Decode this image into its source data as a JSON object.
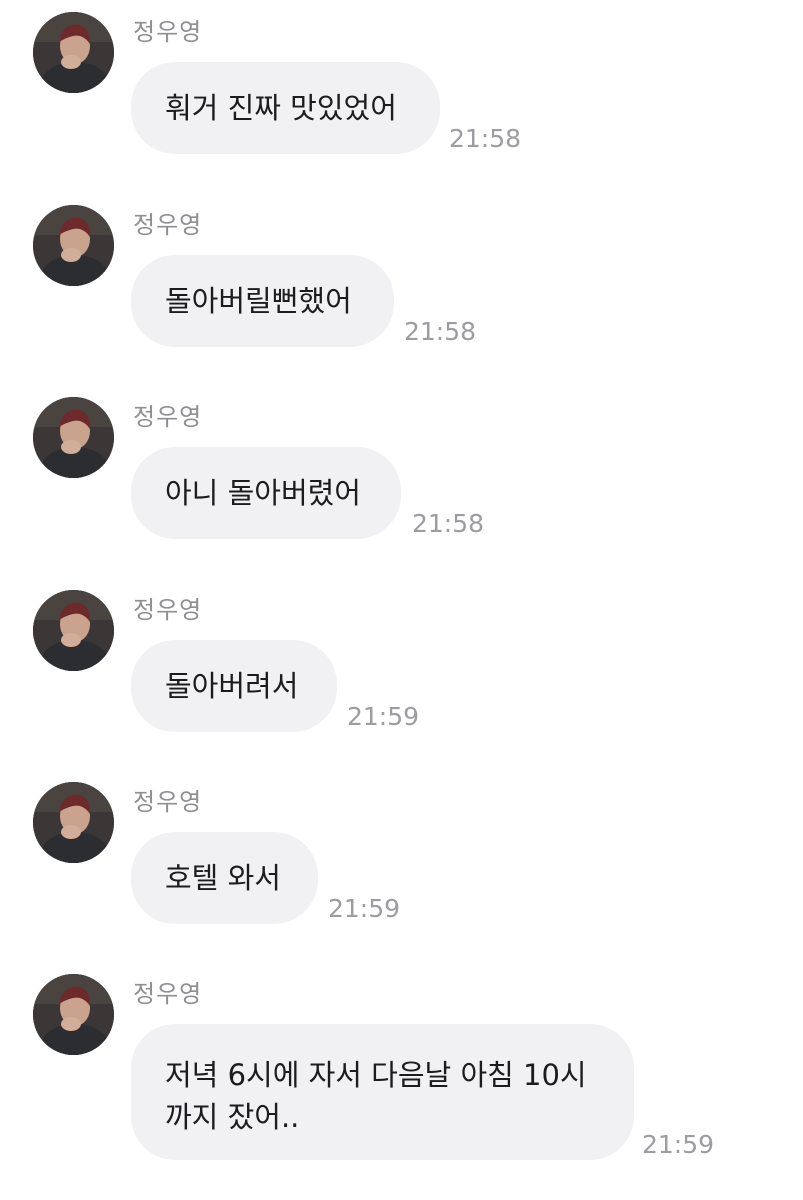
{
  "messages": [
    {
      "sender": "정우영",
      "text": [
        "훠거 진짜 맛있었어"
      ],
      "time": "21:58",
      "avatar_icon": "profile-photo"
    },
    {
      "sender": "정우영",
      "text": [
        "돌아버릴뻔했어"
      ],
      "time": "21:58",
      "avatar_icon": "profile-photo"
    },
    {
      "sender": "정우영",
      "text": [
        "아니 돌아버렸어"
      ],
      "time": "21:58",
      "avatar_icon": "profile-photo"
    },
    {
      "sender": "정우영",
      "text": [
        "돌아버려서"
      ],
      "time": "21:59",
      "avatar_icon": "profile-photo"
    },
    {
      "sender": "정우영",
      "text": [
        "호텔 와서"
      ],
      "time": "21:59",
      "avatar_icon": "profile-photo"
    },
    {
      "sender": "정우영",
      "text": [
        "저녁 6시에 자서 다음날 아침 10시",
        "까지 잤어.."
      ],
      "time": "21:59",
      "avatar_icon": "profile-photo"
    }
  ],
  "colors": {
    "bubble_bg": "#f1f1f4",
    "sender": "#8e8e93",
    "time": "#9c9ca1",
    "text": "#1c1c1e"
  }
}
